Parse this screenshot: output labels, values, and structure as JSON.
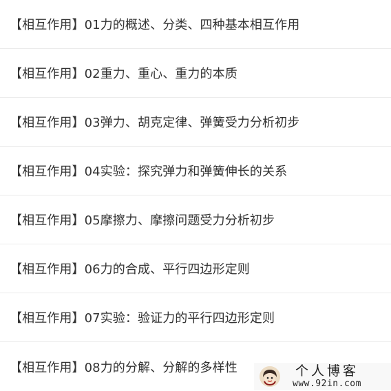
{
  "items": [
    {
      "title": "【相互作用】01力的概述、分类、四种基本相互作用"
    },
    {
      "title": "【相互作用】02重力、重心、重力的本质"
    },
    {
      "title": "【相互作用】03弹力、胡克定律、弹簧受力分析初步"
    },
    {
      "title": "【相互作用】04实验：探究弹力和弹簧伸长的关系"
    },
    {
      "title": "【相互作用】05摩擦力、摩擦问题受力分析初步"
    },
    {
      "title": "【相互作用】06力的合成、平行四边形定则"
    },
    {
      "title": "【相互作用】07实验：验证力的平行四边形定则"
    },
    {
      "title": "【相互作用】08力的分解、分解的多样性"
    }
  ],
  "watermark": {
    "title": "个人博客",
    "url": "www.92in.com",
    "avatar_icon": "cartoon-avatar-icon"
  }
}
